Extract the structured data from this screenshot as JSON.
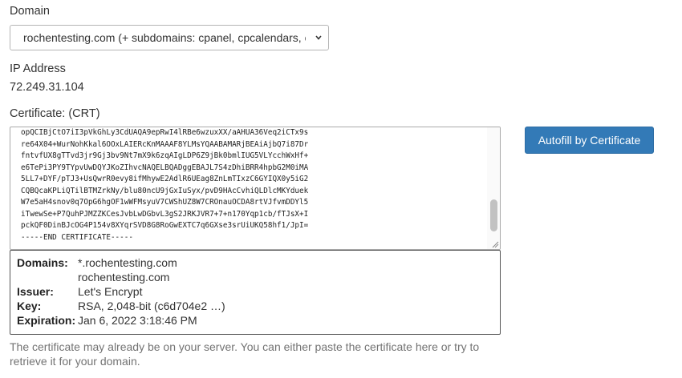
{
  "domain": {
    "label": "Domain",
    "selected": "rochentesting.com    (+ subdomains: cpanel, cpcalendars, cpcontacts, mail, webdisk, webmail, www)"
  },
  "ip": {
    "label": "IP Address",
    "value": "72.249.31.104"
  },
  "certificate": {
    "label": "Certificate: (CRT)",
    "lines": [
      "opQCIBjCtO7iI3pVkGhLy3CdUAQA9epRwI4lRBe6wzuxXX/aAHUA36Veq2iCTx9s",
      "re64X04+WurNohKkal6OOxLAIERcKnMAAAF8YLMsYQAABAMARjBEAiAjbQ7i87Dr",
      "fntvfUX8gTTvd3jr9Gj3bv9Nt7mX9k6zqAIgLDP6Z9jBk0bmlIUG5VLYcchWxHf+",
      "e6TePi3PY9TYpvUwDQYJKoZIhvcNAQELBQADggEBAJL7S4zDhiBRR4hpbG2M0iMA",
      "5LL7+DYF/pTJ3+UsQwrR0evy8ifMhywE2AdlR6UEag8ZnLmTIxzC6GYIQX0y5iG2",
      "CQBQcaKPLiQTilBTMZrkNy/blu80ncU9jGxIuSyx/pvD9HAcCvhiQLDlcMKYduek",
      "W7e5aH4snov0q7OpG6hgOF1wWFMsyuV7CWShUZ8W7CROnauOCDA8rtVJfvmDDYl5",
      "iTwewSe+P7QuhPJMZZKCesJvbLwDGbvL3gS2JRKJVR7+7+n170Yqp1cb/fTJsX+I",
      "pckQF0DinBJcOG4P154v8XYqrSVD8G8RoGwEXTC7q6GXse3srUiUKQ58hf1/JpI=",
      "-----END CERTIFICATE-----"
    ]
  },
  "info": {
    "domains_key": "Domains:",
    "domains": [
      "*.rochentesting.com",
      "rochentesting.com"
    ],
    "issuer_key": "Issuer:",
    "issuer": "Let's Encrypt",
    "key_key": "Key:",
    "key": "RSA, 2,048-bit (c6d704e2 …)",
    "expiration_key": "Expiration:",
    "expiration": "Jan 6, 2022 3:18:46 PM"
  },
  "hint": "The certificate may already be on your server. You can either paste the certificate here or try to retrieve it for your domain.",
  "autofill_button": "Autofill by Certificate",
  "colors": {
    "primary_button": "#337ab7",
    "hint_text": "#737373"
  }
}
